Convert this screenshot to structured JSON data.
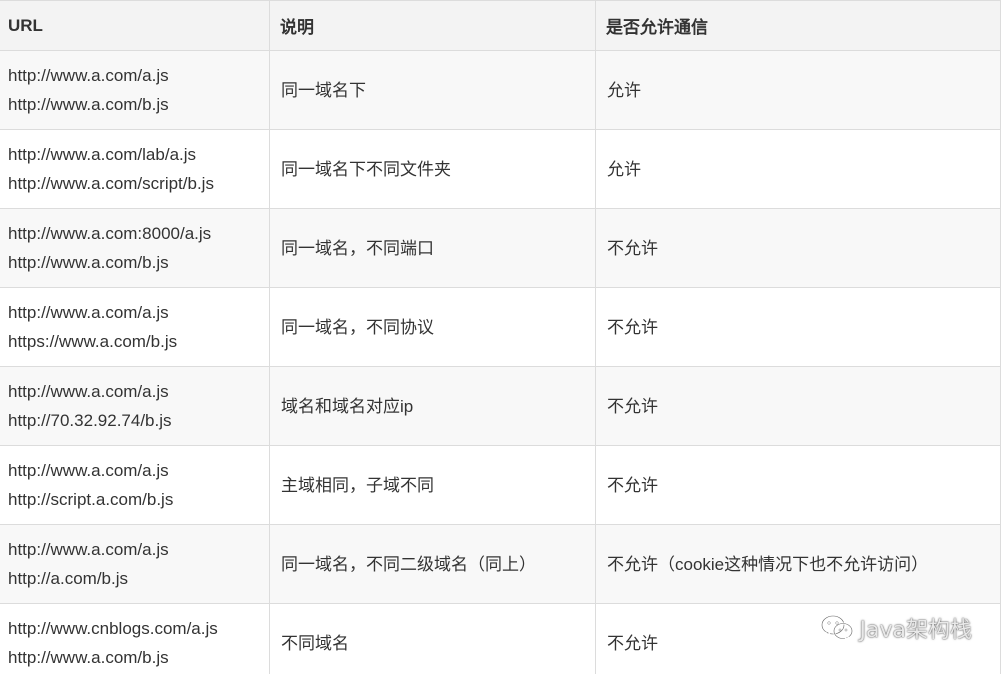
{
  "table": {
    "headers": {
      "url": "URL",
      "desc": "说明",
      "allowed": "是否允许通信"
    },
    "rows": [
      {
        "url1": "http://www.a.com/a.js",
        "url2": "http://www.a.com/b.js",
        "desc": "同一域名下",
        "allowed": "允许"
      },
      {
        "url1": "http://www.a.com/lab/a.js",
        "url2": "http://www.a.com/script/b.js",
        "desc": "同一域名下不同文件夹",
        "allowed": "允许"
      },
      {
        "url1": "http://www.a.com:8000/a.js",
        "url2": "http://www.a.com/b.js",
        "desc": "同一域名，不同端口",
        "allowed": "不允许"
      },
      {
        "url1": "http://www.a.com/a.js",
        "url2": "https://www.a.com/b.js",
        "desc": "同一域名，不同协议",
        "allowed": "不允许"
      },
      {
        "url1": "http://www.a.com/a.js",
        "url2": "http://70.32.92.74/b.js",
        "desc": "域名和域名对应ip",
        "allowed": "不允许"
      },
      {
        "url1": "http://www.a.com/a.js",
        "url2": "http://script.a.com/b.js",
        "desc": "主域相同，子域不同",
        "allowed": "不允许"
      },
      {
        "url1": "http://www.a.com/a.js",
        "url2": "http://a.com/b.js",
        "desc": "同一域名，不同二级域名（同上）",
        "allowed": "不允许（cookie这种情况下也不允许访问）"
      },
      {
        "url1": "http://www.cnblogs.com/a.js",
        "url2": "http://www.a.com/b.js",
        "desc": "不同域名",
        "allowed": "不允许"
      }
    ]
  },
  "watermark": {
    "text": "Java架构栈",
    "icon": "wechat-icon"
  }
}
